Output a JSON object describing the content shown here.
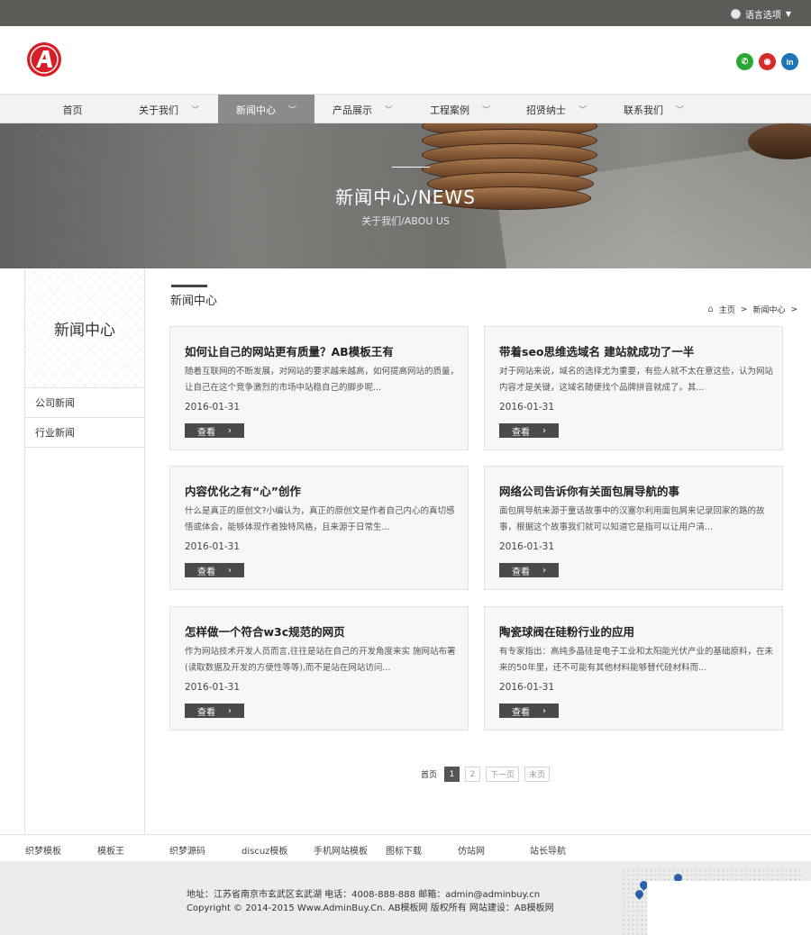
{
  "topbar": {
    "language_label": "语言选项"
  },
  "header": {
    "logo_letter": "A"
  },
  "social": [
    "wechat-icon",
    "weibo-icon",
    "linkedin-icon"
  ],
  "nav": {
    "items": [
      {
        "label": "首页",
        "dropdown": false
      },
      {
        "label": "关于我们",
        "dropdown": true
      },
      {
        "label": "新闻中心",
        "dropdown": true,
        "active": true
      },
      {
        "label": "产品展示",
        "dropdown": true
      },
      {
        "label": "工程案例",
        "dropdown": true
      },
      {
        "label": "招贤纳士",
        "dropdown": true
      },
      {
        "label": "联系我们",
        "dropdown": true
      }
    ]
  },
  "banner": {
    "title": "新闻中心/NEWS",
    "subtitle": "关于我们/ABOU US"
  },
  "sidebar": {
    "title": "新闻中心",
    "items": [
      "公司新闻",
      "行业新闻"
    ]
  },
  "content": {
    "section_title": "新闻中心",
    "breadcrumb": {
      "home": "主页",
      "sep": ">",
      "current": "新闻中心",
      "trail": ">"
    },
    "cards": [
      {
        "title": "如何让自己的网站更有质量？AB模板王有",
        "desc": "随着互联网的不断发展，对网站的要求越来越高，如何提高网站的质量，让自己在这个竞争激烈的市场中站稳自己的脚步呢...",
        "date": "2016-01-31",
        "button": "查看"
      },
      {
        "title": "带着seo思维选域名 建站就成功了一半",
        "desc": "对于网站来说，域名的选择尤为重要，有些人就不太在意这些，认为网站内容才是关键，这域名随便找个品牌拼音就成了。其...",
        "date": "2016-01-31",
        "button": "查看"
      },
      {
        "title": "内容优化之有“心”创作",
        "desc": "什么是真正的原创文?小编认为，真正的原创文是作者自己内心的真切感悟或体会，能够体现作者独特风格，且来源于日常生...",
        "date": "2016-01-31",
        "button": "查看"
      },
      {
        "title": "网络公司告诉你有关面包屑导航的事",
        "desc": "面包屑导航来源于童话故事中的汉塞尔利用面包屑来记录回家的路的故事，根据这个故事我们就可以知道它是指可以让用户清...",
        "date": "2016-01-31",
        "button": "查看"
      },
      {
        "title": "怎样做一个符合w3c规范的网页",
        "desc": "作为网站技术开发人员而言,往往是站在自己的开发角度来实 施网站布署(读取数据及开发的方便性等等),而不是站在网站访问...",
        "date": "2016-01-31",
        "button": "查看"
      },
      {
        "title": "陶瓷球阀在硅粉行业的应用",
        "desc": "有专家指出：高纯多晶硅是电子工业和太阳能光伏产业的基础原料，在未来的50年里，还不可能有其他材料能够替代硅材料而...",
        "date": "2016-01-31",
        "button": "查看"
      }
    ]
  },
  "pagination": {
    "first": "首页",
    "pages": [
      "1",
      "2"
    ],
    "current": "1",
    "next": "下一页",
    "last": "末页"
  },
  "footer_links": [
    "织梦模板",
    "模板王",
    "织梦源码",
    "discuz模板",
    "手机网站模板",
    "图标下载",
    "仿站网",
    "站长导航"
  ],
  "footer": {
    "address_line": "地址：江苏省南京市玄武区玄武湖    电话：4008-888-888    邮箱：admin@adminbuy.cn",
    "copyright_line": "Copyright © 2014-2015 Www.AdminBuy.Cn. AB模板网 版权所有    网站建设：AB模板网"
  }
}
